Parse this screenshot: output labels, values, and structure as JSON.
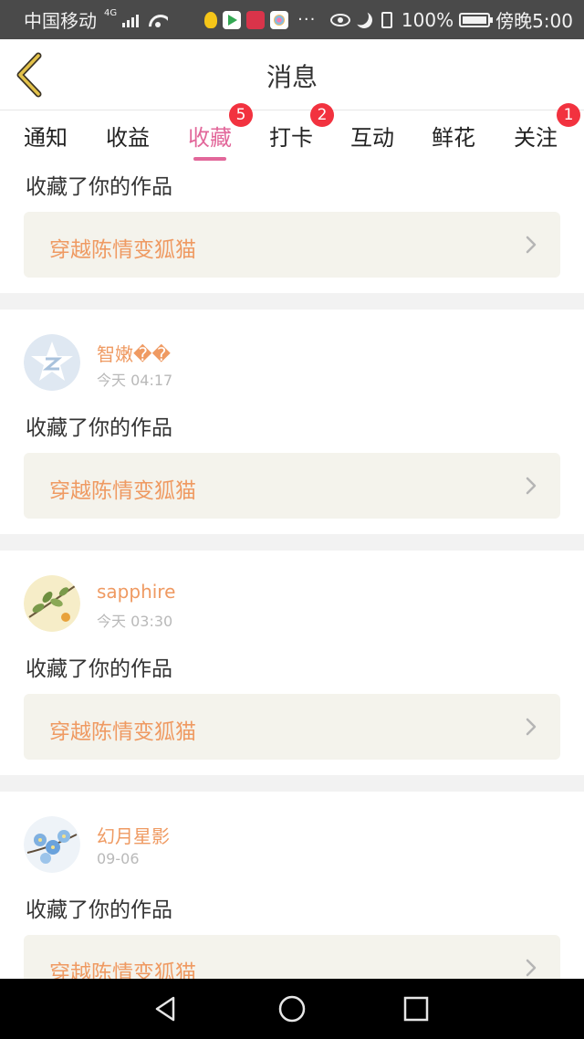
{
  "status_bar": {
    "carrier": "中国移动",
    "network": "4G",
    "battery": "100%",
    "time": "傍晚5:00",
    "more": "···",
    "icons": [
      "signal-icon",
      "wifi-icon",
      "notification-app-icons",
      "eye-comfort-icon",
      "moon-icon",
      "vibrate-icon",
      "battery-icon"
    ]
  },
  "header": {
    "title": "消息",
    "back_icon": "chevron-left-icon",
    "back_color": "#d6b23b"
  },
  "tabs": [
    {
      "label": "通知",
      "badge": ""
    },
    {
      "label": "收益",
      "badge": ""
    },
    {
      "label": "收藏",
      "badge": "5"
    },
    {
      "label": "打卡",
      "badge": "2"
    },
    {
      "label": "互动",
      "badge": ""
    },
    {
      "label": "鲜花",
      "badge": ""
    },
    {
      "label": "关注",
      "badge": "1"
    }
  ],
  "active_tab": "收藏",
  "colors": {
    "accent": "#e2679a",
    "badge": "#f2323f",
    "username": "#ef9a62",
    "work_box": "#f4f3ec"
  },
  "partial_item": {
    "action": "收藏了你的作品",
    "work_title": "穿越陈情变狐猫"
  },
  "items": [
    {
      "username": "智嫩��",
      "time": "今天 04:17",
      "action": "收藏了你的作品",
      "work_title": "穿越陈情变狐猫",
      "avatar": "qzone-star-avatar"
    },
    {
      "username": "sapphire",
      "time": "今天 03:30",
      "action": "收藏了你的作品",
      "work_title": "穿越陈情变狐猫",
      "avatar": "branch-with-leaves-avatar"
    },
    {
      "username": "幻月星影",
      "time": "09-06",
      "action": "收藏了你的作品",
      "work_title": "穿越陈情变狐猫",
      "avatar": "blue-flowers-avatar"
    }
  ],
  "nav": {
    "back_icon": "triangle-back-icon",
    "home_icon": "circle-home-icon",
    "recents_icon": "square-recents-icon"
  }
}
